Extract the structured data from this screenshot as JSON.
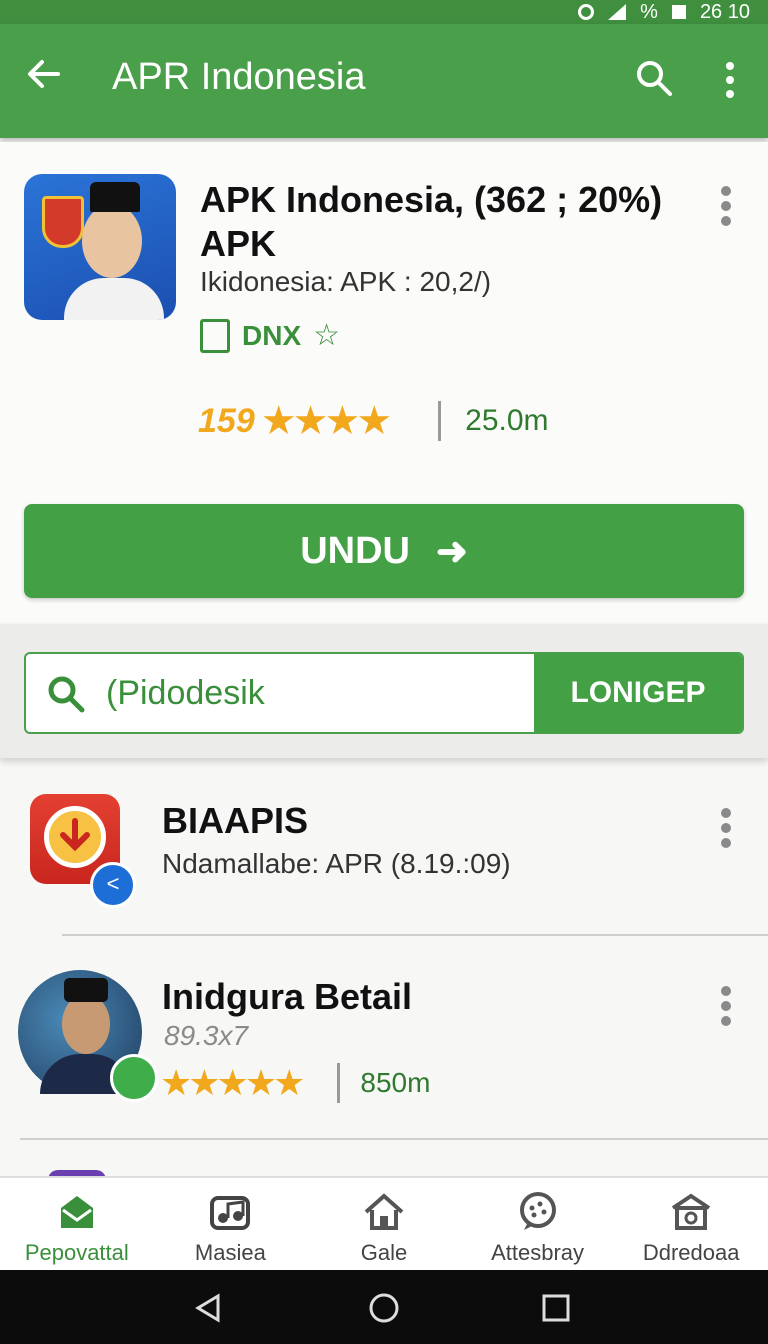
{
  "status_bar": {
    "signal_text": "%",
    "time": "26 10"
  },
  "app_bar": {
    "title": "APR Indonesia",
    "back_icon": "arrow-back-icon",
    "search_icon": "search-icon",
    "more_icon": "more-vert-icon"
  },
  "featured_app": {
    "name": "APK Indonesia, (362 ; 20%) APK",
    "subtitle": "Ikidonesia: APK : 20,2/)",
    "developer": "DNX",
    "developer_icon": "clipboard-icon",
    "favorite_icon": "star-outline-icon",
    "rating_number": "159",
    "rating_stars": "★★★★",
    "size": "25.0m",
    "install_button": "UNDU",
    "install_arrow": "➜"
  },
  "search": {
    "value": "(Pidodesik",
    "button_label": "LONIGEP",
    "icon": "search-icon"
  },
  "list": [
    {
      "title": "BIAAPIS",
      "subtitle": "Ndamallabe: APR (8.19.:09)",
      "icon": "download-app-icon"
    },
    {
      "title": "Inidgura Betail",
      "subtitle": "89.3x7",
      "rating_stars": "★★★★★",
      "size": "850m",
      "icon": "avatar-app-icon"
    }
  ],
  "bottom_nav": [
    {
      "label": "Pepovattal",
      "icon": "store-icon",
      "active": true
    },
    {
      "label": "Masiea",
      "icon": "music-icon",
      "active": false
    },
    {
      "label": "Gale",
      "icon": "home-icon",
      "active": false
    },
    {
      "label": "Attesbray",
      "icon": "chat-bubble-icon",
      "active": false
    },
    {
      "label": "Ddredoaa",
      "icon": "shop-house-icon",
      "active": false
    }
  ],
  "colors": {
    "primary": "#4aa04a",
    "primary_dark": "#3f8f3f",
    "accent_star": "#f2a81d"
  }
}
